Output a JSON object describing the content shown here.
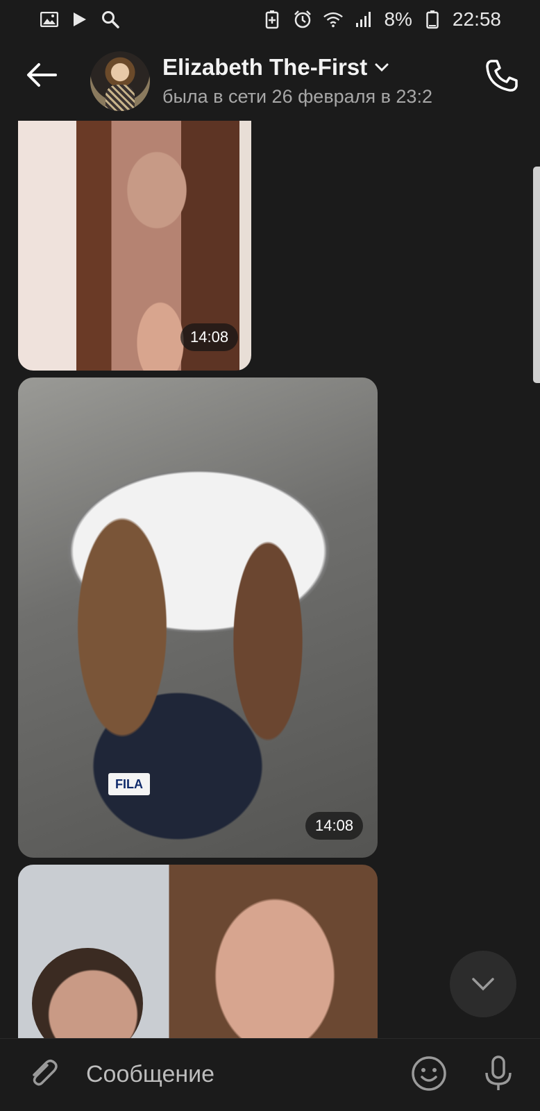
{
  "status_bar": {
    "battery_percent": "8%",
    "time": "22:58",
    "icons": [
      "image-icon",
      "play-icon",
      "search-icon",
      "battery-saver-icon",
      "alarm-icon",
      "wifi-icon",
      "signal-icon",
      "battery-icon"
    ]
  },
  "header": {
    "contact_name": "Elizabeth The-First",
    "status": "была в сети 26 февраля в 23:2"
  },
  "messages": [
    {
      "type": "photo",
      "time": "14:08"
    },
    {
      "type": "photo",
      "time": "14:08",
      "brand_text": "FILA"
    },
    {
      "type": "photo"
    }
  ],
  "composer": {
    "placeholder": "Сообщение"
  },
  "colors": {
    "background": "#1b1b1b",
    "text": "#ffffff",
    "secondary_text": "#a8a8a8"
  }
}
